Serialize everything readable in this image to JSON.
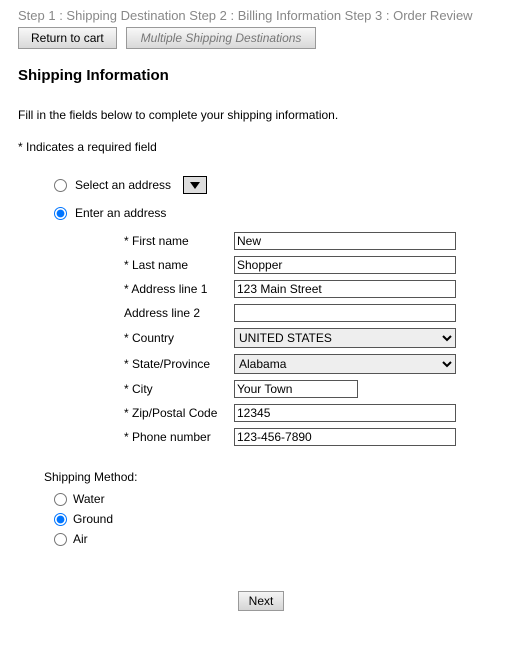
{
  "steps": {
    "step1": "Step 1 : Shipping Destination",
    "step2": "Step 2 : Billing Information",
    "step3": "Step 3 : Order Review"
  },
  "buttons": {
    "return_to_cart": "Return to cart",
    "multiple_dest": "Multiple Shipping Destinations",
    "next": "Next"
  },
  "headings": {
    "section": "Shipping Information",
    "intro": "Fill in the fields below to complete your shipping information.",
    "required_note": "* Indicates a required field",
    "shipping_method": "Shipping Method:"
  },
  "address_mode": {
    "select_label": "Select an address",
    "enter_label": "Enter an address",
    "selected": "enter"
  },
  "form": {
    "first_name": {
      "label": "* First name",
      "value": "New"
    },
    "last_name": {
      "label": "* Last name",
      "value": "Shopper"
    },
    "address1": {
      "label": "* Address line 1",
      "value": "123 Main Street"
    },
    "address2": {
      "label": "Address line 2",
      "value": ""
    },
    "country": {
      "label": "* Country",
      "value": "UNITED STATES",
      "options": [
        "UNITED STATES"
      ]
    },
    "state": {
      "label": "* State/Province",
      "value": "Alabama",
      "options": [
        "Alabama"
      ]
    },
    "city": {
      "label": "* City",
      "value": "Your Town"
    },
    "zip": {
      "label": "* Zip/Postal Code",
      "value": "12345"
    },
    "phone": {
      "label": "* Phone number",
      "value": "123-456-7890"
    }
  },
  "shipping_methods": {
    "options": [
      {
        "key": "water",
        "label": "Water"
      },
      {
        "key": "ground",
        "label": "Ground"
      },
      {
        "key": "air",
        "label": "Air"
      }
    ],
    "selected": "ground"
  }
}
